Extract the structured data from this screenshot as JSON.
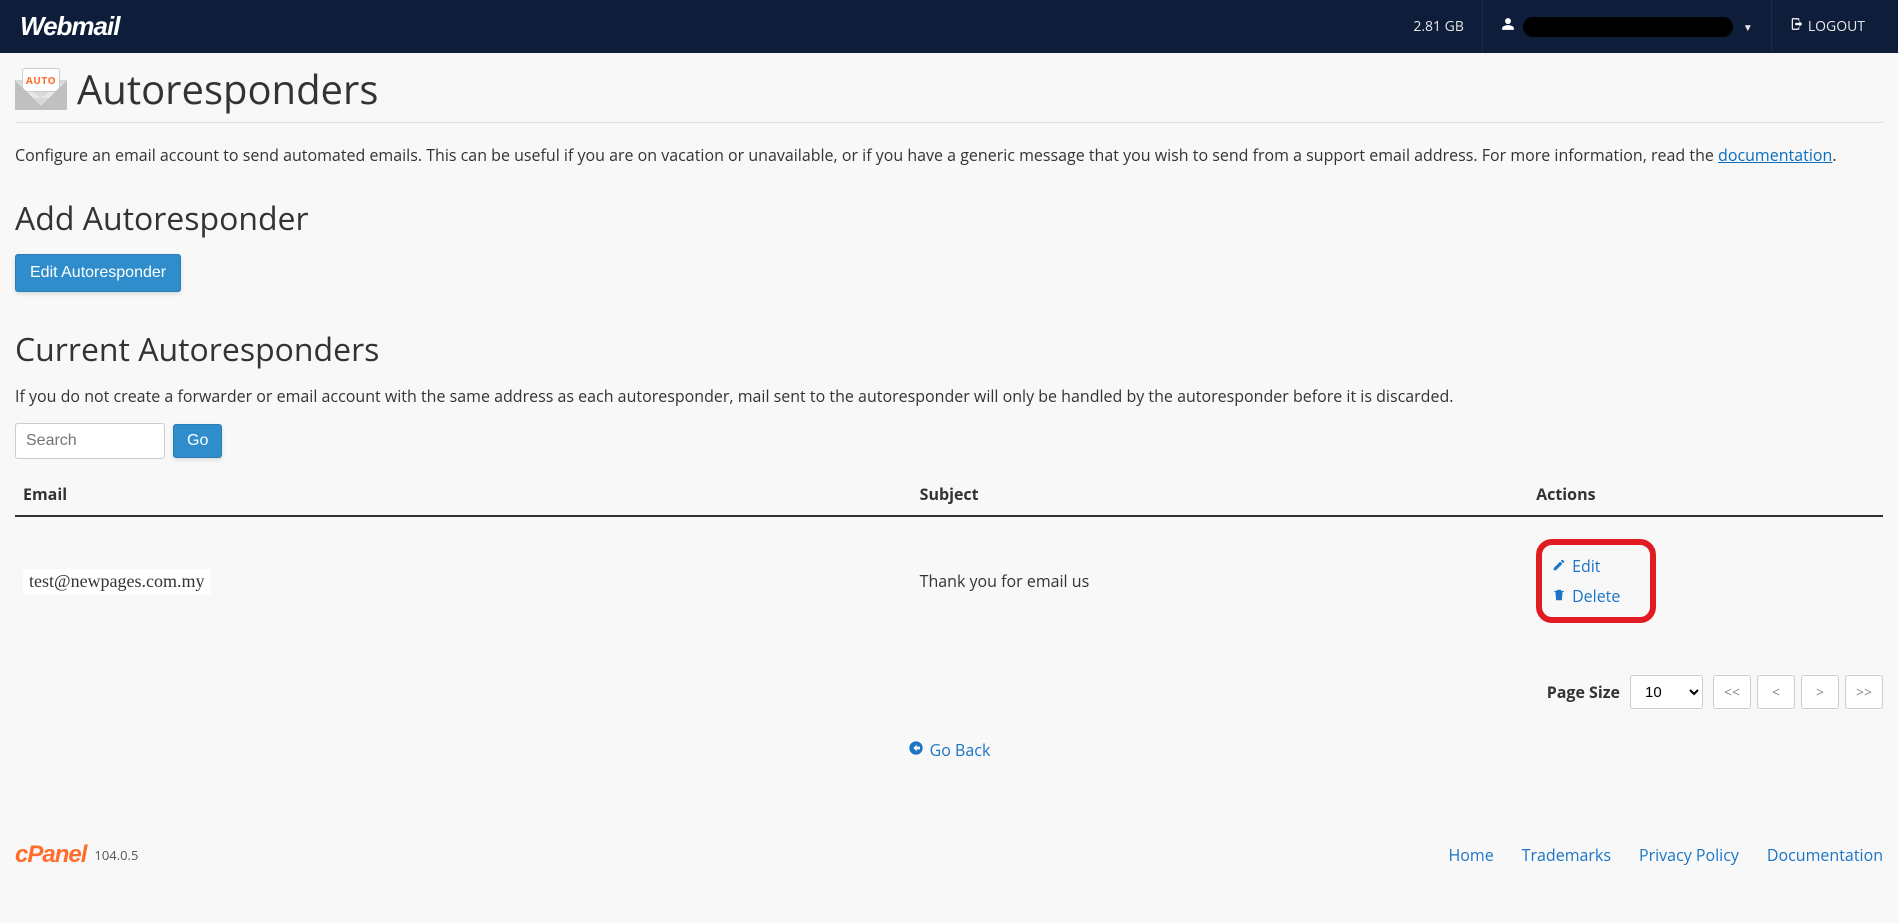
{
  "header": {
    "brand": "Webmail",
    "storage": "2.81 GB",
    "logout_label": "LOGOUT"
  },
  "page": {
    "title": "Autoresponders",
    "icon_badge": "AUTO",
    "description_prefix": "Configure an email account to send automated emails. This can be useful if you are on vacation or unavailable, or if you have a generic message that you wish to send from a support email address. For more information, read the ",
    "description_link": "documentation",
    "description_suffix": "."
  },
  "add": {
    "heading": "Add Autoresponder",
    "button_label": "Edit Autoresponder"
  },
  "current": {
    "heading": "Current Autoresponders",
    "note": "If you do not create a forwarder or email account with the same address as each autoresponder, mail sent to the autoresponder will only be handled by the autoresponder before it is discarded.",
    "search_placeholder": "Search",
    "go_label": "Go",
    "columns": {
      "email": "Email",
      "subject": "Subject",
      "actions": "Actions"
    },
    "rows": [
      {
        "email": "test@newpages.com.my",
        "subject": "Thank you for email us"
      }
    ],
    "actions": {
      "edit": "Edit",
      "delete": "Delete"
    }
  },
  "pager": {
    "page_size_label": "Page Size",
    "page_size_value": "10",
    "first": "<<",
    "prev": "<",
    "next": ">",
    "last": ">>"
  },
  "goback_label": "Go Back",
  "footer": {
    "cpanel_label": "cPanel",
    "version": "104.0.5",
    "links": {
      "home": "Home",
      "trademarks": "Trademarks",
      "privacy": "Privacy Policy",
      "docs": "Documentation"
    }
  }
}
